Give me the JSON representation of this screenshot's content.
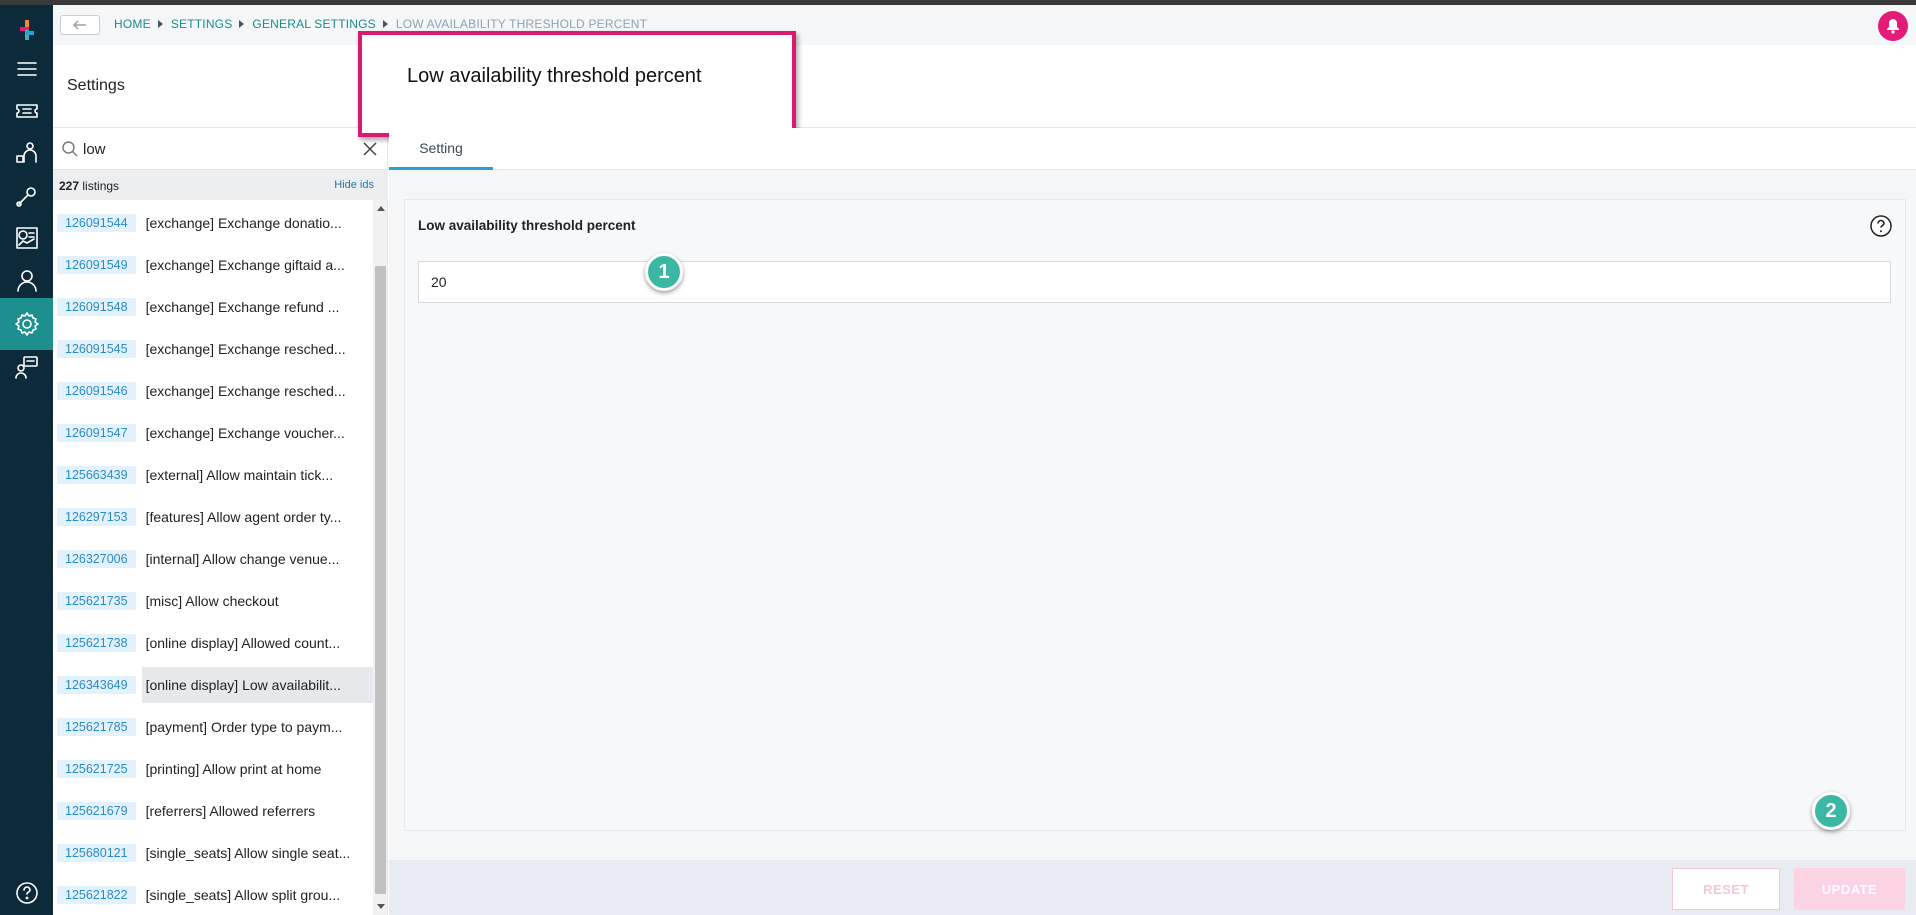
{
  "breadcrumb": {
    "items": [
      "HOME",
      "SETTINGS",
      "GENERAL SETTINGS",
      "LOW AVAILABILITY THRESHOLD PERCENT"
    ]
  },
  "rail": {
    "icons": [
      "logo-icon",
      "menu-icon",
      "tickets-icon",
      "venue-icon",
      "tools-icon",
      "reports-icon",
      "user-icon",
      "gear-icon",
      "support-icon",
      "help-icon"
    ],
    "active": "gear-icon"
  },
  "sidebar": {
    "title": "Settings",
    "search_value": "low",
    "listings_count": "227",
    "listings_word": "listings",
    "hide_ids_label": "Hide ids",
    "items": [
      {
        "id": "126091544",
        "label": "[exchange] Exchange donatio..."
      },
      {
        "id": "126091549",
        "label": "[exchange] Exchange giftaid a..."
      },
      {
        "id": "126091548",
        "label": "[exchange] Exchange refund ..."
      },
      {
        "id": "126091545",
        "label": "[exchange] Exchange resched..."
      },
      {
        "id": "126091546",
        "label": "[exchange] Exchange resched..."
      },
      {
        "id": "126091547",
        "label": "[exchange] Exchange voucher..."
      },
      {
        "id": "125663439",
        "label": "[external] Allow maintain tick..."
      },
      {
        "id": "126297153",
        "label": "[features] Allow agent order ty..."
      },
      {
        "id": "126327006",
        "label": "[internal] Allow change venue..."
      },
      {
        "id": "125621735",
        "label": "[misc] Allow checkout"
      },
      {
        "id": "125621738",
        "label": "[online display] Allowed count..."
      },
      {
        "id": "126343649",
        "label": "[online display] Low availabilit..."
      },
      {
        "id": "125621785",
        "label": "[payment] Order type to paym..."
      },
      {
        "id": "125621725",
        "label": "[printing] Allow print at home"
      },
      {
        "id": "125621679",
        "label": "[referrers] Allowed referrers"
      },
      {
        "id": "125680121",
        "label": "[single_seats] Allow single seat..."
      },
      {
        "id": "125621822",
        "label": "[single_seats] Allow split grou..."
      }
    ],
    "selected_index": 11
  },
  "main": {
    "title": "Low availability threshold percent",
    "tab_label": "Setting",
    "field_label": "Low availability threshold percent",
    "field_value": "20",
    "reset_label": "RESET",
    "update_label": "UPDATE"
  },
  "markers": [
    "1",
    "2"
  ],
  "colors": {
    "rail": "#0d2a3a",
    "accent_teal": "#1d8f8f",
    "brand_pink": "#e31b7a",
    "highlight_box": "#d91b6e",
    "tab_underline": "#2a9fd8",
    "marker": "#3bb8a4"
  }
}
